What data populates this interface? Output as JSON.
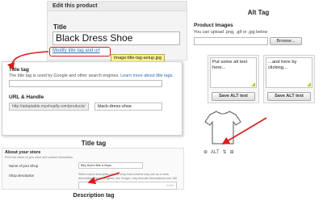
{
  "edit_panel": {
    "header": "Edit this product",
    "title_label": "Title",
    "title_value": "Black Dress Shoe",
    "modify_link": "Modify title tag and url",
    "tooltip": "Image:title-tag-setup.jpg"
  },
  "seo_panel": {
    "title_tag_label": "Title tag",
    "title_tag_help": "The title tag is used by Google and other search engines.",
    "learn_more_link": "Learn more about title tags.",
    "url_label": "URL & Handle",
    "url_prefix": "http://adaptable.myshopify.com/products/",
    "url_handle": "black-dress-shoe"
  },
  "captions": {
    "title_tag": "Title tag",
    "description_tag": "Description tag",
    "alt_tag": "Alt Tag"
  },
  "store_panel": {
    "title": "About your store",
    "subtitle": "Fill in the name of your store and contact information.",
    "shop_name_label": "Name of your Shop",
    "shop_name_value": "Billy Bob's Bits & Bops",
    "shop_description_label": "Shop description",
    "shop_description_help": "Write a short description of your shop that a theme may use as a meta description. Search engines, like Google, may truncate descriptions over 160 characters in the search results.",
    "counter": "0/160"
  },
  "product_images": {
    "title": "Product Images",
    "subtitle": "You can upload .png, .gif or .jpg below",
    "browse_label": "Browse...",
    "cards": [
      {
        "alt_text": "Put some alt text here...",
        "button": "Save ALT text"
      },
      {
        "alt_text": "...and here by clicking...",
        "button": "Save ALT text"
      }
    ],
    "tools": {
      "alt_label": "ALT"
    }
  },
  "colors": {
    "accent_red": "#d4201d",
    "link_blue": "#2a6eb5",
    "tooltip_yellow": "#fbf38f",
    "grip_green": "#aacc33"
  }
}
